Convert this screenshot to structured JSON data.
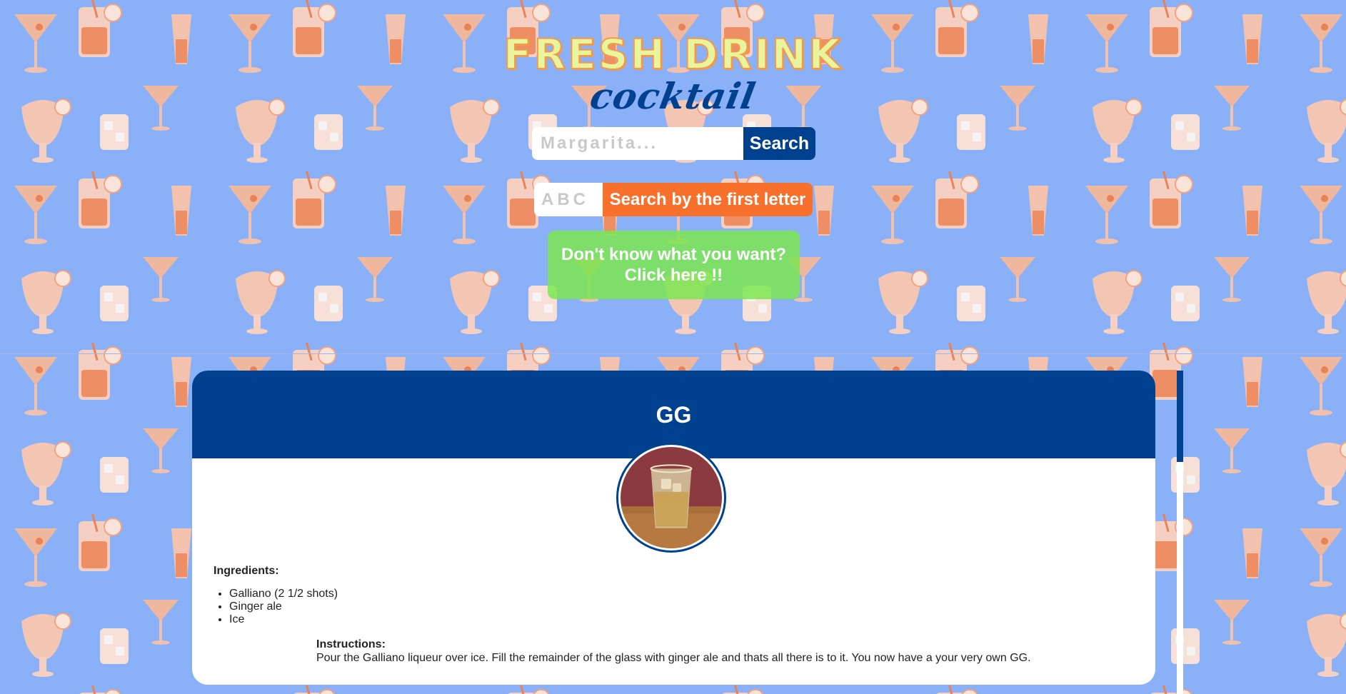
{
  "header": {
    "title": "FRESH DRINK",
    "subtitle": "cocktail"
  },
  "search": {
    "placeholder": "Margarita...",
    "value": "",
    "button_label": "Search"
  },
  "letter_search": {
    "placeholder": "ABC",
    "value": "",
    "button_label": "Search by the first letter"
  },
  "random": {
    "line1": "Don't know what you want?",
    "line2": "Click here !!"
  },
  "drink": {
    "name": "GG",
    "ingredients_label": "Ingredients:",
    "ingredients": [
      "Galliano (2 1/2 shots)",
      "Ginger ale",
      "Ice"
    ],
    "instructions_label": "Instructions:",
    "instructions": "Pour the Galliano liqueur over ice. Fill the remainder of the glass with ginger ale and thats all there is to it. You now have a your very own GG."
  },
  "colors": {
    "background": "#8ab0f7",
    "primary": "#00418f",
    "accent": "#f7702c",
    "random_button": "#7ae650",
    "title_fill": "#e9f59c",
    "title_outline": "#f29a4b"
  },
  "icons": {
    "background_pattern": "cocktail-glass-pattern",
    "drink_photo": "drink-photo"
  }
}
